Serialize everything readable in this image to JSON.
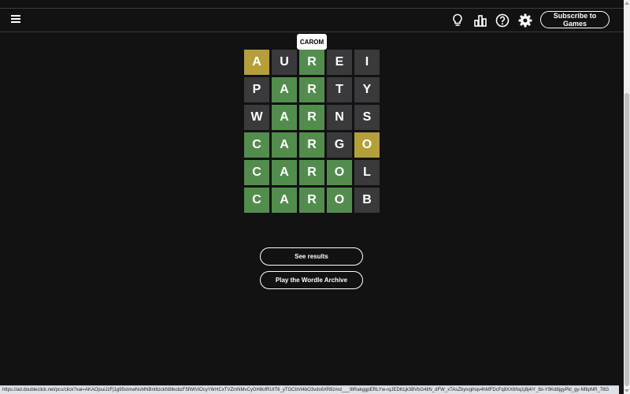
{
  "header": {
    "subscribe_label": "Subscribe to Games",
    "icons": [
      "menu-icon",
      "lightbulb-icon",
      "bar-chart-icon",
      "help-icon",
      "gear-icon"
    ]
  },
  "toast": {
    "text": "CAROM"
  },
  "board": {
    "rows": [
      [
        {
          "letter": "A",
          "state": "present"
        },
        {
          "letter": "U",
          "state": "absent"
        },
        {
          "letter": "R",
          "state": "correct"
        },
        {
          "letter": "E",
          "state": "absent"
        },
        {
          "letter": "I",
          "state": "absent"
        }
      ],
      [
        {
          "letter": "P",
          "state": "absent"
        },
        {
          "letter": "A",
          "state": "correct"
        },
        {
          "letter": "R",
          "state": "correct"
        },
        {
          "letter": "T",
          "state": "absent"
        },
        {
          "letter": "Y",
          "state": "absent"
        }
      ],
      [
        {
          "letter": "W",
          "state": "absent"
        },
        {
          "letter": "A",
          "state": "correct"
        },
        {
          "letter": "R",
          "state": "correct"
        },
        {
          "letter": "N",
          "state": "absent"
        },
        {
          "letter": "S",
          "state": "absent"
        }
      ],
      [
        {
          "letter": "C",
          "state": "correct"
        },
        {
          "letter": "A",
          "state": "correct"
        },
        {
          "letter": "R",
          "state": "correct"
        },
        {
          "letter": "G",
          "state": "absent"
        },
        {
          "letter": "O",
          "state": "present"
        }
      ],
      [
        {
          "letter": "C",
          "state": "correct"
        },
        {
          "letter": "A",
          "state": "correct"
        },
        {
          "letter": "R",
          "state": "correct"
        },
        {
          "letter": "O",
          "state": "correct"
        },
        {
          "letter": "L",
          "state": "absent"
        }
      ],
      [
        {
          "letter": "C",
          "state": "correct"
        },
        {
          "letter": "A",
          "state": "correct"
        },
        {
          "letter": "R",
          "state": "correct"
        },
        {
          "letter": "O",
          "state": "correct"
        },
        {
          "letter": "B",
          "state": "absent"
        }
      ]
    ]
  },
  "actions": {
    "see_results": "See results",
    "play_archive": "Play the Wordle Archive"
  },
  "status_bar": {
    "url": "https://ad.doubleclick.net/pcs/click?xai=AKAOjsuiJzFj1g95stmwNsMNBnt6zckN8tkobzF5fWtViOcyY6rHCxTVZmNMvCyGH8ofRUtT6_yTGCbVt4bO3vds6XR8zmd___9tRakggpERLYw-rqJED61jk3BVbG4tlN_dFW_xTAsZbyivgihqv4hMFDcFq8XX6Nq1j8j4iY_tbi-Y9Kd8jgyPkl_gy-NftipNR_78G"
  },
  "colors": {
    "correct": "#538d4e",
    "present": "#b59f3b",
    "absent": "#3a3a3c",
    "background": "#121213"
  }
}
